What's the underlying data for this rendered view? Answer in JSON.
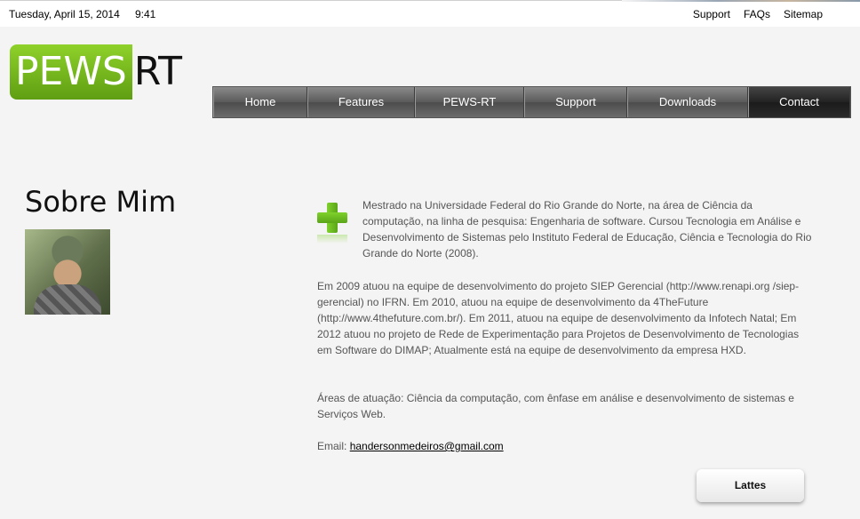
{
  "topbar": {
    "date": "Tuesday, April 15, 2014",
    "time": "9:41",
    "links": [
      "Support",
      "FAQs",
      "Sitemap"
    ]
  },
  "logo": {
    "part1": "PEWS",
    "part2": "RT"
  },
  "nav": {
    "items": [
      "Home",
      "Features",
      "PEWS-RT",
      "Support",
      "Downloads",
      "Contact"
    ],
    "active": "Contact"
  },
  "page": {
    "title": "Sobre Mim",
    "p1": "Mestrado na Universidade Federal do Rio Grande do Norte, na área de Ciência da computação, na linha de pesquisa: Engenharia de software. Cursou Tecnologia em Análise e Desenvolvimento de Sistemas pelo Instituto Federal de Educação, Ciência e Tecnologia do Rio Grande do Norte (2008).",
    "p2": "Em 2009 atuou na equipe de desenvolvimento do projeto SIEP Gerencial (http://www.renapi.org /siep-gerencial) no IFRN. Em 2010, atuou na equipe de desenvolvimento da 4TheFuture (http://www.4thefuture.com.br/). Em 2011, atuou na equipe de desenvolvimento da Infotech Natal; Em 2012 atuou no projeto de Rede de Experimentação para Projetos de Desenvolvimento de Tecnologias em Software do DIMAP; Atualmente está na equipe de desenvolvimento da empresa HXD.",
    "p3": "Áreas de atuação: Ciência da computação, com ênfase em análise e desenvolvimento de sistemas e Serviços Web.",
    "email_label": "Email: ",
    "email": "handersonmedeiros@gmail.com",
    "button": "Lattes"
  },
  "colors": {
    "logo_green": "#6fb41c",
    "nav_gray": "#5a5a5a",
    "nav_active": "#222222"
  }
}
